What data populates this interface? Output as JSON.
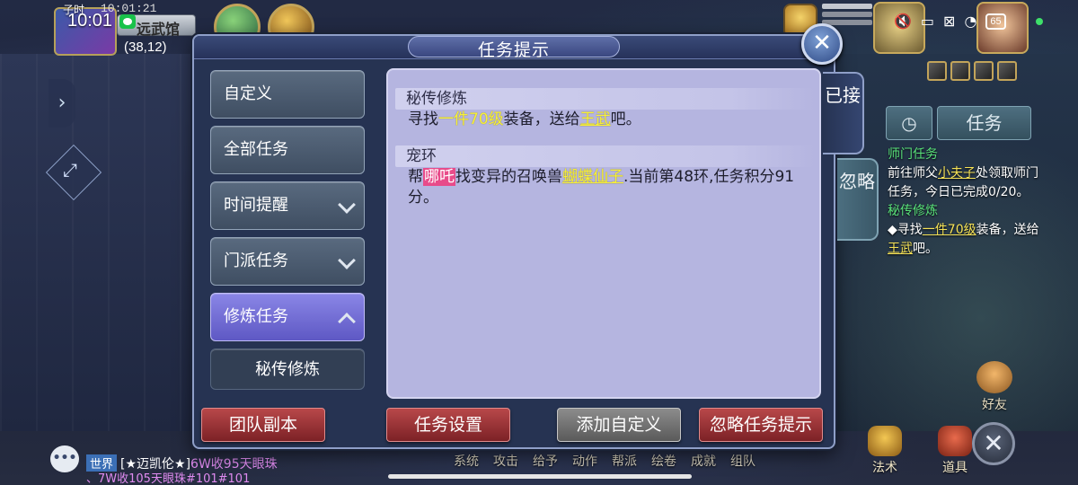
{
  "status_bar": {
    "clock": "10:01",
    "game_time_label": "子时",
    "game_clock": "10:01:21",
    "map_name": "远武馆",
    "map_coords": "(38,12)",
    "battery": "65"
  },
  "dialog": {
    "title": "任务提示",
    "close_label": "✕",
    "categories": [
      {
        "label": "自定义"
      },
      {
        "label": "全部任务"
      },
      {
        "label": "时间提醒"
      },
      {
        "label": "门派任务"
      },
      {
        "label": "修炼任务"
      },
      {
        "label": "秘传修炼"
      }
    ],
    "tabs": {
      "accepted": "已接",
      "ignored": "忽略"
    },
    "tasks": [
      {
        "name": "秘传修炼",
        "desc_parts": [
          "寻找",
          "一件70级",
          "装备，送给",
          "王武",
          "吧。"
        ]
      },
      {
        "name": "宠环",
        "desc_parts": [
          "帮",
          "哪吒",
          "找变异的召唤兽",
          "蝴蝶仙子",
          ".当前第48环,任务积分91分。"
        ]
      }
    ],
    "buttons": {
      "team_dungeon": "团队副本",
      "task_settings": "任务设置",
      "add_custom": "添加自定义",
      "ignore_hints": "忽略任务提示"
    }
  },
  "tracker": {
    "timer_icon": "clock-icon",
    "tab_label": "任务",
    "sect_title": "师门任务",
    "sect_text_1": "前往师父",
    "sect_master": "小夫子",
    "sect_text_2": "处领取师门任务，今日已完成0/20。",
    "secret_title": "秘传修炼",
    "secret_text_1": "◆寻找",
    "secret_item": "一件70级",
    "secret_text_2": "装备，送给",
    "secret_npc": "王武",
    "secret_text_3": "吧。"
  },
  "chat": {
    "channel": "世界",
    "sender": "[★迈凯伦★]",
    "line1_msg": "6W收95天眼珠",
    "line2_msg": "、7W收105天眼珠#101#101"
  },
  "bottom_menu": [
    "系统",
    "攻击",
    "给予",
    "动作",
    "帮派",
    "绘卷",
    "成就",
    "组队"
  ],
  "bottom_icons": [
    "法术",
    "道具"
  ],
  "friend_label": "好友",
  "colors": {
    "highlight_yellow": "#f7f03a",
    "highlight_pink": "#e84b8a",
    "active_category": "#7470d8",
    "tracker_green": "#59e17a"
  }
}
